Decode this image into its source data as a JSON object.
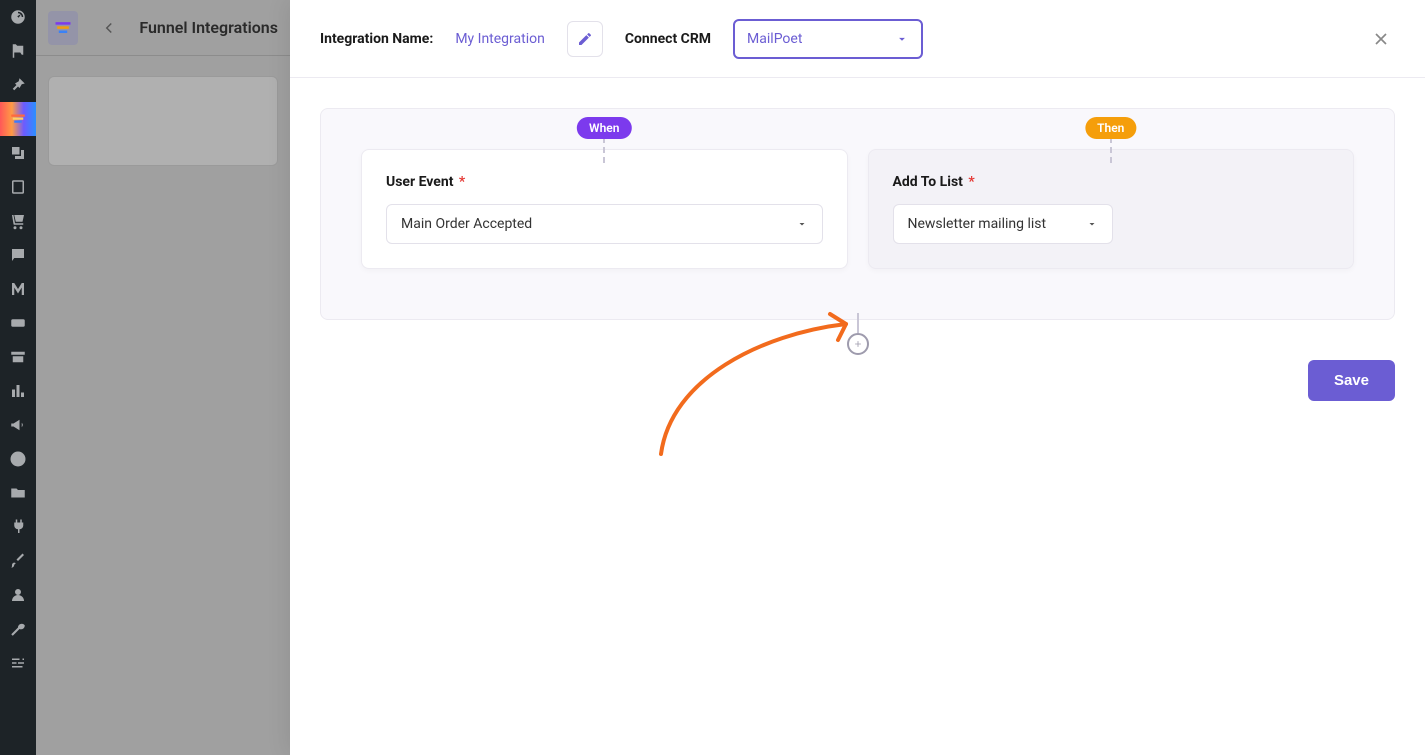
{
  "page": {
    "title": "Funnel Integrations"
  },
  "header": {
    "name_label": "Integration Name:",
    "name_value": "My Integration",
    "crm_label": "Connect CRM",
    "crm_value": "MailPoet"
  },
  "rule": {
    "when_badge": "When",
    "then_badge": "Then",
    "when": {
      "label": "User Event",
      "value": "Main Order Accepted"
    },
    "then": {
      "label": "Add To List",
      "value": "Newsletter mailing list"
    },
    "required_marker": "*"
  },
  "actions": {
    "save": "Save"
  },
  "sidebar": {
    "active_index": 3
  }
}
